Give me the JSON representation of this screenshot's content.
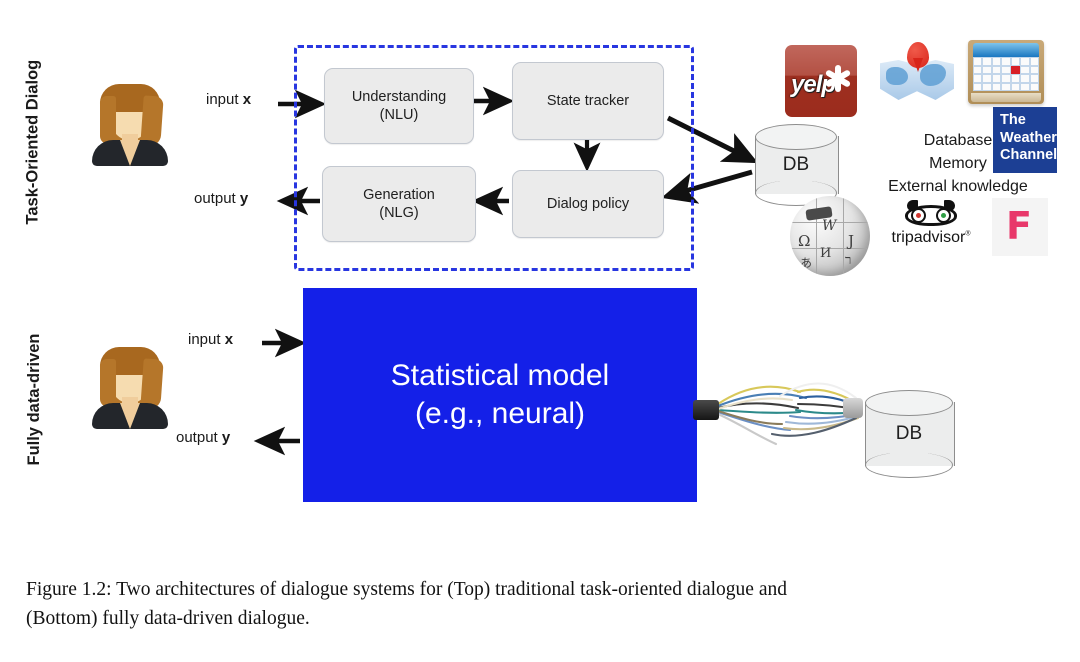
{
  "figure": {
    "caption_line1": "Figure 1.2:  Two architectures of dialogue systems for (Top) traditional task-oriented dialogue and",
    "caption_line2": "(Bottom) fully data-driven dialogue."
  },
  "rows": {
    "top_label": "Task-Oriented Dialog",
    "bottom_label": "Fully data-driven"
  },
  "io": {
    "input_top": "input ",
    "input_top_var": "x",
    "output_top": "output ",
    "output_top_var": "y",
    "input_bottom": "input ",
    "input_bottom_var": "x",
    "output_bottom": "output ",
    "output_bottom_var": "y"
  },
  "pipeline": {
    "nlu_line1": "Understanding",
    "nlu_line2": "(NLU)",
    "state_tracker": "State tracker",
    "dialog_policy": "Dialog policy",
    "nlg_line1": "Generation",
    "nlg_line2": "(NLG)"
  },
  "model": {
    "line1": "Statistical model",
    "line2": "(e.g., neural)"
  },
  "databases": {
    "top_db_label": "DB",
    "bottom_db_label": "DB"
  },
  "knowledge": {
    "line1": "Database",
    "line2": "Memory",
    "line3": "External knowledge"
  },
  "logos": {
    "yelp": "yelp",
    "weather_line1": "The",
    "weather_line2": "Weather",
    "weather_line3": "Channel",
    "tripadvisor": "tripadvisor",
    "tripadvisor_mark": "®",
    "foursquare": "F",
    "wiki_glyph1": "Ω",
    "wiki_glyph2": "W",
    "wiki_glyph3": "J",
    "wiki_glyph4": "И",
    "wiki_glyph5": "ר",
    "wiki_glyph6": "あ"
  },
  "colors": {
    "model_blue": "#1420e8",
    "dashed_border": "#2836e0",
    "box_gray": "#ebebeb",
    "yelp_red": "#9e2f20",
    "weather_navy": "#1c3f94",
    "foursquare_pink": "#e8386a"
  }
}
